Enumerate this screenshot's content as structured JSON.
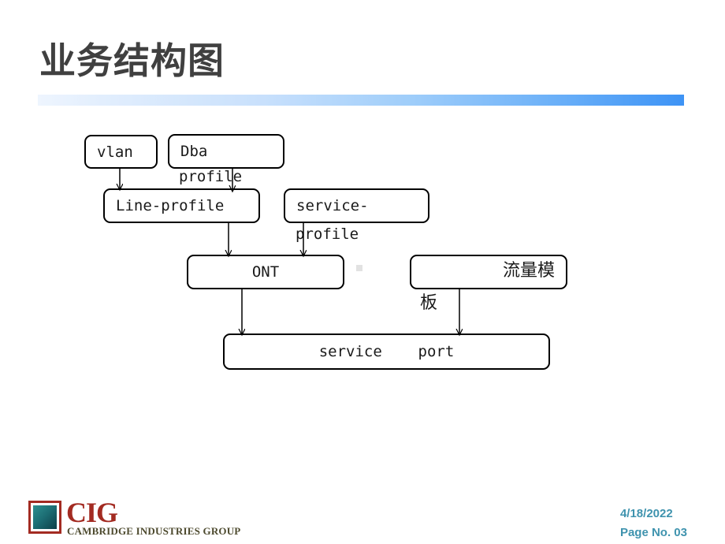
{
  "slide": {
    "title": "业务结构图",
    "accent_color": "#3d93f5",
    "title_color": "#404040"
  },
  "diagram": {
    "nodes": [
      {
        "id": "vlan",
        "label": "vlan",
        "overflow": ""
      },
      {
        "id": "dba-profile",
        "label": "Dba",
        "overflow": "profile"
      },
      {
        "id": "line-profile",
        "label": "Line-profile",
        "overflow": ""
      },
      {
        "id": "service-profile",
        "label": "service-",
        "overflow": "profile"
      },
      {
        "id": "ont",
        "label": "ONT",
        "overflow": ""
      },
      {
        "id": "traffic-model",
        "label": "流量模",
        "overflow": "板"
      },
      {
        "id": "service-port",
        "label": "service    port",
        "overflow": ""
      }
    ],
    "edges": [
      {
        "from": "vlan",
        "to": "line-profile"
      },
      {
        "from": "dba-profile",
        "to": "line-profile"
      },
      {
        "from": "line-profile",
        "to": "ont"
      },
      {
        "from": "service-profile",
        "to": "ont"
      },
      {
        "from": "ont",
        "to": "service-port"
      },
      {
        "from": "traffic-model",
        "to": "service-port"
      }
    ]
  },
  "footer": {
    "logo_word": "CIG",
    "logo_tagline": "CAMBRIDGE INDUSTRIES GROUP",
    "date": "4/18/2022",
    "page": "Page No. 03",
    "meta_color": "#3f93ae",
    "logo_color": "#a32b22"
  }
}
